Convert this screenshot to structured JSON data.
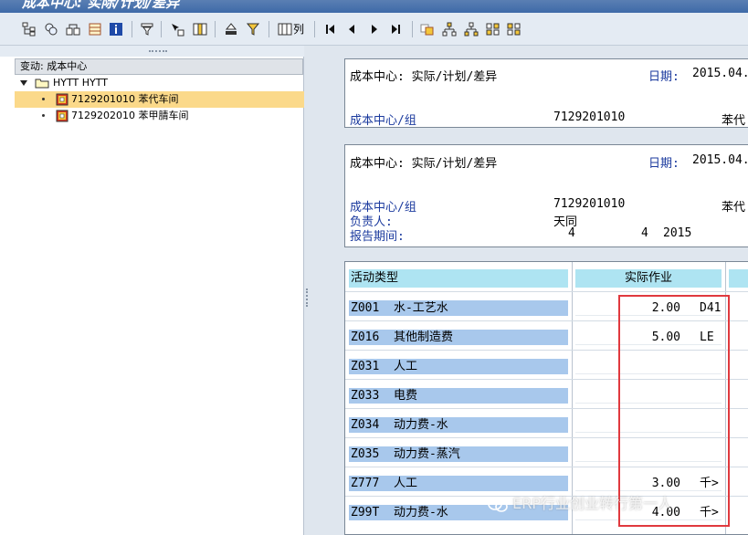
{
  "window": {
    "title": "成本中心: 实际/计划/差异"
  },
  "toolbar": {
    "list_label": "列",
    "icons": [
      "hierarchy-icon",
      "find-icon",
      "objects-icon",
      "layout-icon",
      "info-icon",
      "filter-icon",
      "select-icon",
      "columns-icon",
      "print-icon",
      "sort-icon",
      "list-icon",
      "first-page-icon",
      "previous-page-icon",
      "next-page-icon",
      "last-page-icon",
      "copy-icon",
      "hierarchy-expand-icon",
      "hierarchy-collapse-icon",
      "node-expand-icon",
      "node-collapse-icon"
    ]
  },
  "tree": {
    "header": "变动: 成本中心",
    "root": {
      "label": "HYTT HYTT"
    },
    "items": [
      {
        "label": "7129201010 苯代车间",
        "selected": true
      },
      {
        "label": "7129202010 苯甲腈车间",
        "selected": false
      }
    ]
  },
  "report": {
    "box1": {
      "title": "成本中心: 实际/计划/差异",
      "date_label": "日期:",
      "date_value": "2015.04.",
      "cc_label": "成本中心/组",
      "cc_value": "7129201010",
      "cc_name": "苯代"
    },
    "box2": {
      "title": "成本中心: 实际/计划/差异",
      "date_label": "日期:",
      "date_value": "2015.04.",
      "cc_label": "成本中心/组",
      "cc_value": "7129201010",
      "cc_name": "苯代",
      "resp_label": "负责人:",
      "resp_value": "天同",
      "period_label": "报告期间:",
      "period_from": "4",
      "period_to": "4",
      "period_year": "2015"
    },
    "grid": {
      "col_activity": "活动类型",
      "col_actual": "实际作业",
      "rows": [
        {
          "code": "Z001",
          "name": "水-工艺水",
          "value": "2.00",
          "unit": "D41"
        },
        {
          "code": "Z016",
          "name": "其他制造费",
          "value": "5.00",
          "unit": "LE"
        },
        {
          "code": "Z031",
          "name": "人工",
          "value": "",
          "unit": ""
        },
        {
          "code": "Z033",
          "name": "电费",
          "value": "",
          "unit": ""
        },
        {
          "code": "Z034",
          "name": "动力费-水",
          "value": "",
          "unit": ""
        },
        {
          "code": "Z035",
          "name": "动力费-蒸汽",
          "value": "",
          "unit": ""
        },
        {
          "code": "Z777",
          "name": "人工",
          "value": "3.00",
          "unit": "千>"
        },
        {
          "code": "Z99T",
          "name": "动力费-水",
          "value": "4.00",
          "unit": "千>"
        }
      ]
    }
  },
  "watermark": "ERP行业创业转行第一人"
}
